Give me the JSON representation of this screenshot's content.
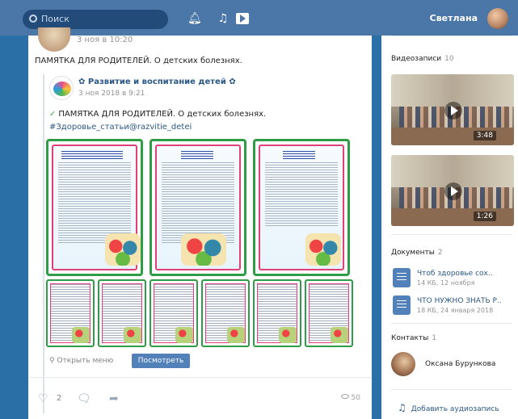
{
  "topbar": {
    "search_placeholder": "Поиск",
    "user_name": "Светлана"
  },
  "post": {
    "time": "3 ноя в 10:20",
    "text": "ПАМЯТКА ДЛЯ РОДИТЕЛЕЙ. О детских болезнях.",
    "repost": {
      "group_name": "✿ Развитие и воспитание детей ✿",
      "time": "3 ноя 2018 в 9:21",
      "text": "ПАМЯТКА ДЛЯ РОДИТЕЛЕЙ. О детских болезнях.",
      "hashtag": "#Здоровье_статьи@razvitie_detei",
      "open_menu": "Открыть меню",
      "view_button": "Посмотреть"
    },
    "likes": "2",
    "views": "50"
  },
  "sidebar": {
    "videos": {
      "title": "Видеозаписи",
      "count": "10",
      "items": [
        {
          "duration": "3:48"
        },
        {
          "duration": "1:26"
        }
      ]
    },
    "documents": {
      "title": "Документы",
      "count": "2",
      "items": [
        {
          "name": "Чтоб здоровье сох..",
          "meta": "14 КБ, 12 ноября"
        },
        {
          "name": "ЧТО НУЖНО ЗНАТЬ Р..",
          "meta": "18 КБ, 24 января 2018"
        }
      ]
    },
    "contacts": {
      "title": "Контакты",
      "count": "1",
      "items": [
        {
          "name": "Оксана Бурункова"
        }
      ]
    },
    "add_audio": "Добавить аудиозапись"
  },
  "colors": {
    "topbar": "#4a76a8",
    "link": "#2a5885",
    "button": "#5181b8",
    "page_border_green": "#2f9d48",
    "page_border_pink": "#e0407a"
  },
  "icons": [
    "search-icon",
    "bell-icon",
    "music-icon",
    "play-icon",
    "heart-icon",
    "comment-icon",
    "share-icon",
    "eye-icon",
    "document-icon",
    "music-note-icon"
  ]
}
